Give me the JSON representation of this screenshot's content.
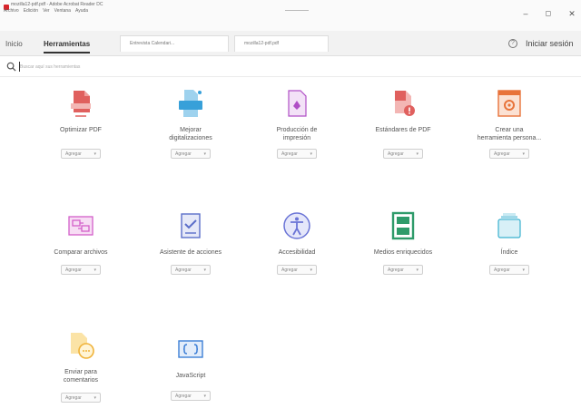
{
  "window": {
    "title": "mozilla12-pdf.pdf - Adobe Acrobat Reader DC",
    "menu": [
      "Archivo",
      "Edición",
      "Ver",
      "Ventana",
      "Ayuda"
    ],
    "minimize": "–",
    "maximize": "◻",
    "close": "✕"
  },
  "tabs": {
    "home": "Inicio",
    "tools": "Herramientas",
    "docs": [
      "Entrevista Calendari...",
      "mozilla12-pdf.pdf"
    ],
    "help": "?",
    "signin": "Iniciar sesión"
  },
  "search": {
    "placeholder": "Buscar aquí sus herramientas"
  },
  "add_label": "Agregar",
  "tools": [
    {
      "label": "Optimizar PDF",
      "icon": "optimize-pdf-icon",
      "color": "#e0605e"
    },
    {
      "label": "Mejorar\ndigitalizaciones",
      "icon": "enhance-scans-icon",
      "color": "#37a0d9"
    },
    {
      "label": "Producción de\nimpresión",
      "icon": "print-production-icon",
      "color": "#b04fc6"
    },
    {
      "label": "Estándares de PDF",
      "icon": "pdf-standards-icon",
      "color": "#e0605e"
    },
    {
      "label": "Crear una\nherramienta persona...",
      "icon": "create-custom-tool-icon",
      "color": "#e8733a"
    },
    {
      "label": "Comparar archivos",
      "icon": "compare-files-icon",
      "color": "#d35fc9"
    },
    {
      "label": "Asistente de acciones",
      "icon": "action-wizard-icon",
      "color": "#5b6ec9"
    },
    {
      "label": "Accesibilidad",
      "icon": "accessibility-icon",
      "color": "#6a74d6"
    },
    {
      "label": "Medios enriquecidos",
      "icon": "rich-media-icon",
      "color": "#2e9b6a"
    },
    {
      "label": "Índice",
      "icon": "index-icon",
      "color": "#38b0cf"
    },
    {
      "label": "Enviar para\ncomentarios",
      "icon": "send-for-comments-icon",
      "color": "#f0b33a"
    },
    {
      "label": "JavaScript",
      "icon": "javascript-icon",
      "color": "#3d7fd6"
    }
  ]
}
